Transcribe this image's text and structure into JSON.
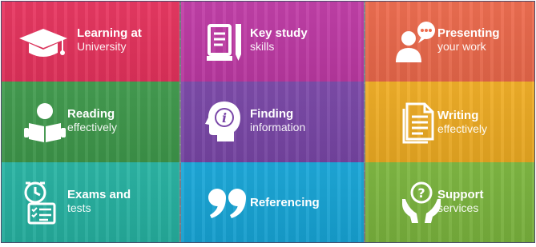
{
  "tiles": [
    {
      "line1": "Learning at",
      "line2": "University",
      "color": "#e8335e",
      "icon": "graduation-cap-icon"
    },
    {
      "line1": "Key study",
      "line2": "skills",
      "color": "#c03aa6",
      "icon": "notebook-pencil-icon"
    },
    {
      "line1": "Presenting",
      "line2": "your work",
      "color": "#ee6a4c",
      "icon": "presenter-speech-icon"
    },
    {
      "line1": "Reading",
      "line2": "effectively",
      "color": "#3f9a4c",
      "icon": "reader-book-icon"
    },
    {
      "line1": "Finding",
      "line2": "information",
      "color": "#7a47a8",
      "icon": "head-info-icon"
    },
    {
      "line1": "Writing",
      "line2": "effectively",
      "color": "#f0ad23",
      "icon": "document-icon"
    },
    {
      "line1": "Exams and",
      "line2": "tests",
      "color": "#26b3a2",
      "icon": "clock-checklist-icon"
    },
    {
      "line1": "Referencing",
      "line2": "",
      "color": "#17a6d8",
      "icon": "quote-marks-icon"
    },
    {
      "line1": "Support",
      "line2": "services",
      "color": "#7cb63e",
      "icon": "hands-question-icon"
    }
  ]
}
